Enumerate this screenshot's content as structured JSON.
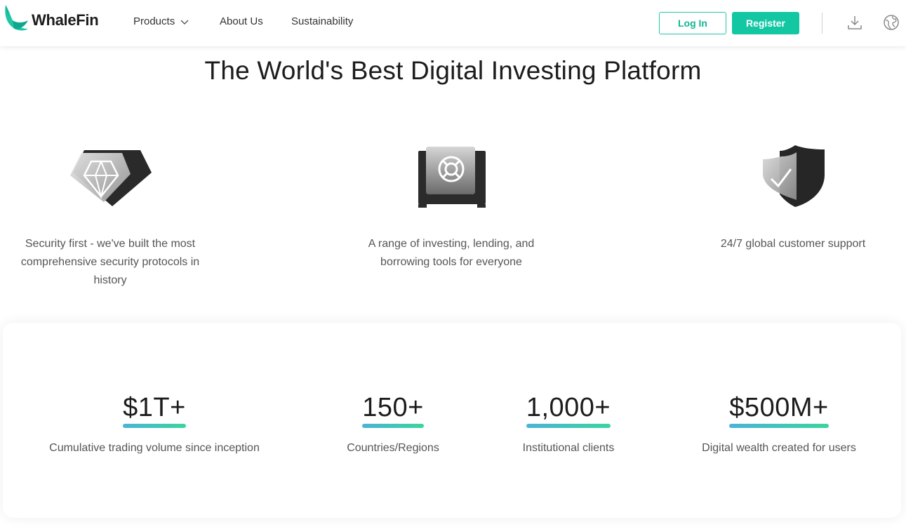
{
  "header": {
    "brand": "WhaleFin",
    "nav": [
      {
        "label": "Products"
      },
      {
        "label": "About Us"
      },
      {
        "label": "Sustainability"
      }
    ],
    "login_label": "Log In",
    "register_label": "Register",
    "icons": [
      "download-icon",
      "globe-icon"
    ],
    "accent_color": "#13c7a3"
  },
  "hero": {
    "title": "The World's Best Digital Investing Platform"
  },
  "features": [
    {
      "icon": "diamond-icon",
      "text": "Security first - we've built the most comprehensive security protocols in history"
    },
    {
      "icon": "safe-icon",
      "text": "A range of investing, lending, and borrowing tools for everyone"
    },
    {
      "icon": "shield-check-icon",
      "text": "24/7 global customer support"
    }
  ],
  "stats": [
    {
      "value": "$1T+",
      "label": "Cumulative trading volume since inception"
    },
    {
      "value": "150+",
      "label": "Countries/Regions"
    },
    {
      "value": "1,000+",
      "label": "Institutional clients"
    },
    {
      "value": "$500M+",
      "label": "Digital wealth created for users"
    }
  ]
}
